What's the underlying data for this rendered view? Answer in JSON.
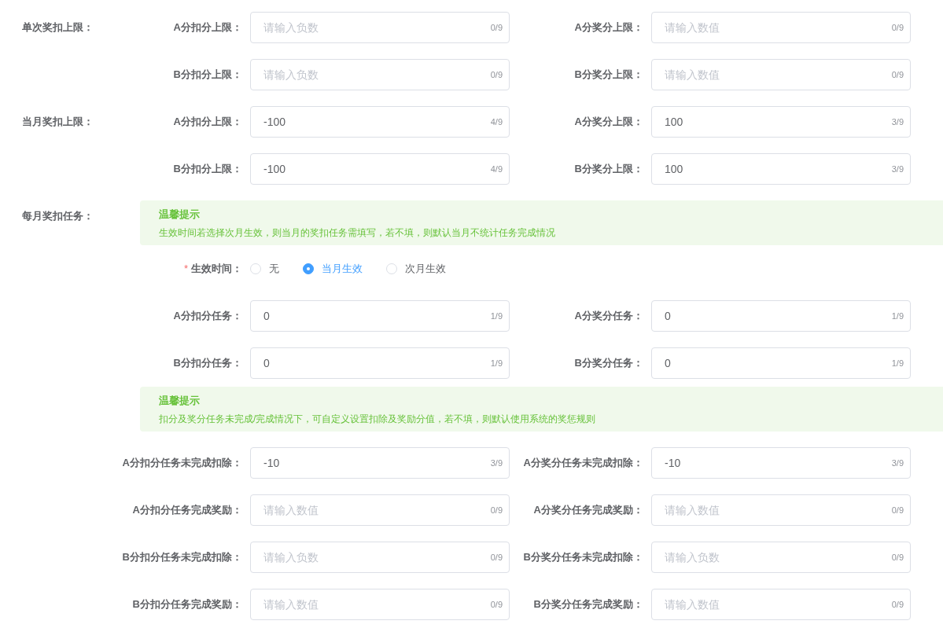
{
  "rows": [
    {
      "kind": "fields",
      "section_label": "单次奖扣上限：",
      "fields": [
        {
          "label": "A分扣分上限：",
          "placeholder": "请输入负数",
          "counter": "0/9"
        },
        {
          "label": "A分奖分上限：",
          "placeholder": "请输入数值",
          "counter": "0/9"
        }
      ]
    },
    {
      "kind": "fields",
      "fields": [
        {
          "label": "B分扣分上限：",
          "placeholder": "请输入负数",
          "counter": "0/9"
        },
        {
          "label": "B分奖分上限：",
          "placeholder": "请输入数值",
          "counter": "0/9"
        }
      ]
    },
    {
      "kind": "fields",
      "section_label": "当月奖扣上限：",
      "fields": [
        {
          "label": "A分扣分上限：",
          "value": "-100",
          "counter": "4/9"
        },
        {
          "label": "A分奖分上限：",
          "value": "100",
          "counter": "3/9"
        }
      ]
    },
    {
      "kind": "fields",
      "fields": [
        {
          "label": "B分扣分上限：",
          "value": "-100",
          "counter": "4/9"
        },
        {
          "label": "B分奖分上限：",
          "value": "100",
          "counter": "3/9"
        }
      ]
    },
    {
      "kind": "alert",
      "section_label": "每月奖扣任务：",
      "title": "温馨提示",
      "text": "生效时间若选择次月生效，则当月的奖扣任务需填写，若不填，则默认当月不统计任务完成情况"
    },
    {
      "kind": "radio",
      "required_mark": "*",
      "label": "生效时间：",
      "options": [
        {
          "label": "无",
          "selected": false
        },
        {
          "label": "当月生效",
          "selected": true
        },
        {
          "label": "次月生效",
          "selected": false
        }
      ]
    },
    {
      "kind": "fields",
      "fields": [
        {
          "label": "A分扣分任务：",
          "value": "0",
          "counter": "1/9"
        },
        {
          "label": "A分奖分任务：",
          "value": "0",
          "counter": "1/9"
        }
      ]
    },
    {
      "kind": "fields",
      "fields": [
        {
          "label": "B分扣分任务：",
          "value": "0",
          "counter": "1/9"
        },
        {
          "label": "B分奖分任务：",
          "value": "0",
          "counter": "1/9"
        }
      ]
    },
    {
      "kind": "alert",
      "title": "温馨提示",
      "text": "扣分及奖分任务未完成/完成情况下，可自定义设置扣除及奖励分值，若不填，则默认使用系统的奖惩规则"
    },
    {
      "kind": "fields",
      "fields": [
        {
          "label": "A分扣分任务未完成扣除：",
          "value": "-10",
          "counter": "3/9"
        },
        {
          "label": "A分奖分任务未完成扣除：",
          "value": "-10",
          "counter": "3/9"
        }
      ]
    },
    {
      "kind": "fields",
      "fields": [
        {
          "label": "A分扣分任务完成奖励：",
          "placeholder": "请输入数值",
          "counter": "0/9"
        },
        {
          "label": "A分奖分任务完成奖励：",
          "placeholder": "请输入数值",
          "counter": "0/9"
        }
      ]
    },
    {
      "kind": "fields",
      "fields": [
        {
          "label": "B分扣分任务未完成扣除：",
          "placeholder": "请输入负数",
          "counter": "0/9"
        },
        {
          "label": "B分奖分任务未完成扣除：",
          "placeholder": "请输入负数",
          "counter": "0/9"
        }
      ]
    },
    {
      "kind": "fields",
      "fields": [
        {
          "label": "B分扣分任务完成奖励：",
          "placeholder": "请输入数值",
          "counter": "0/9"
        },
        {
          "label": "B分奖分任务完成奖励：",
          "placeholder": "请输入数值",
          "counter": "0/9"
        }
      ]
    }
  ]
}
